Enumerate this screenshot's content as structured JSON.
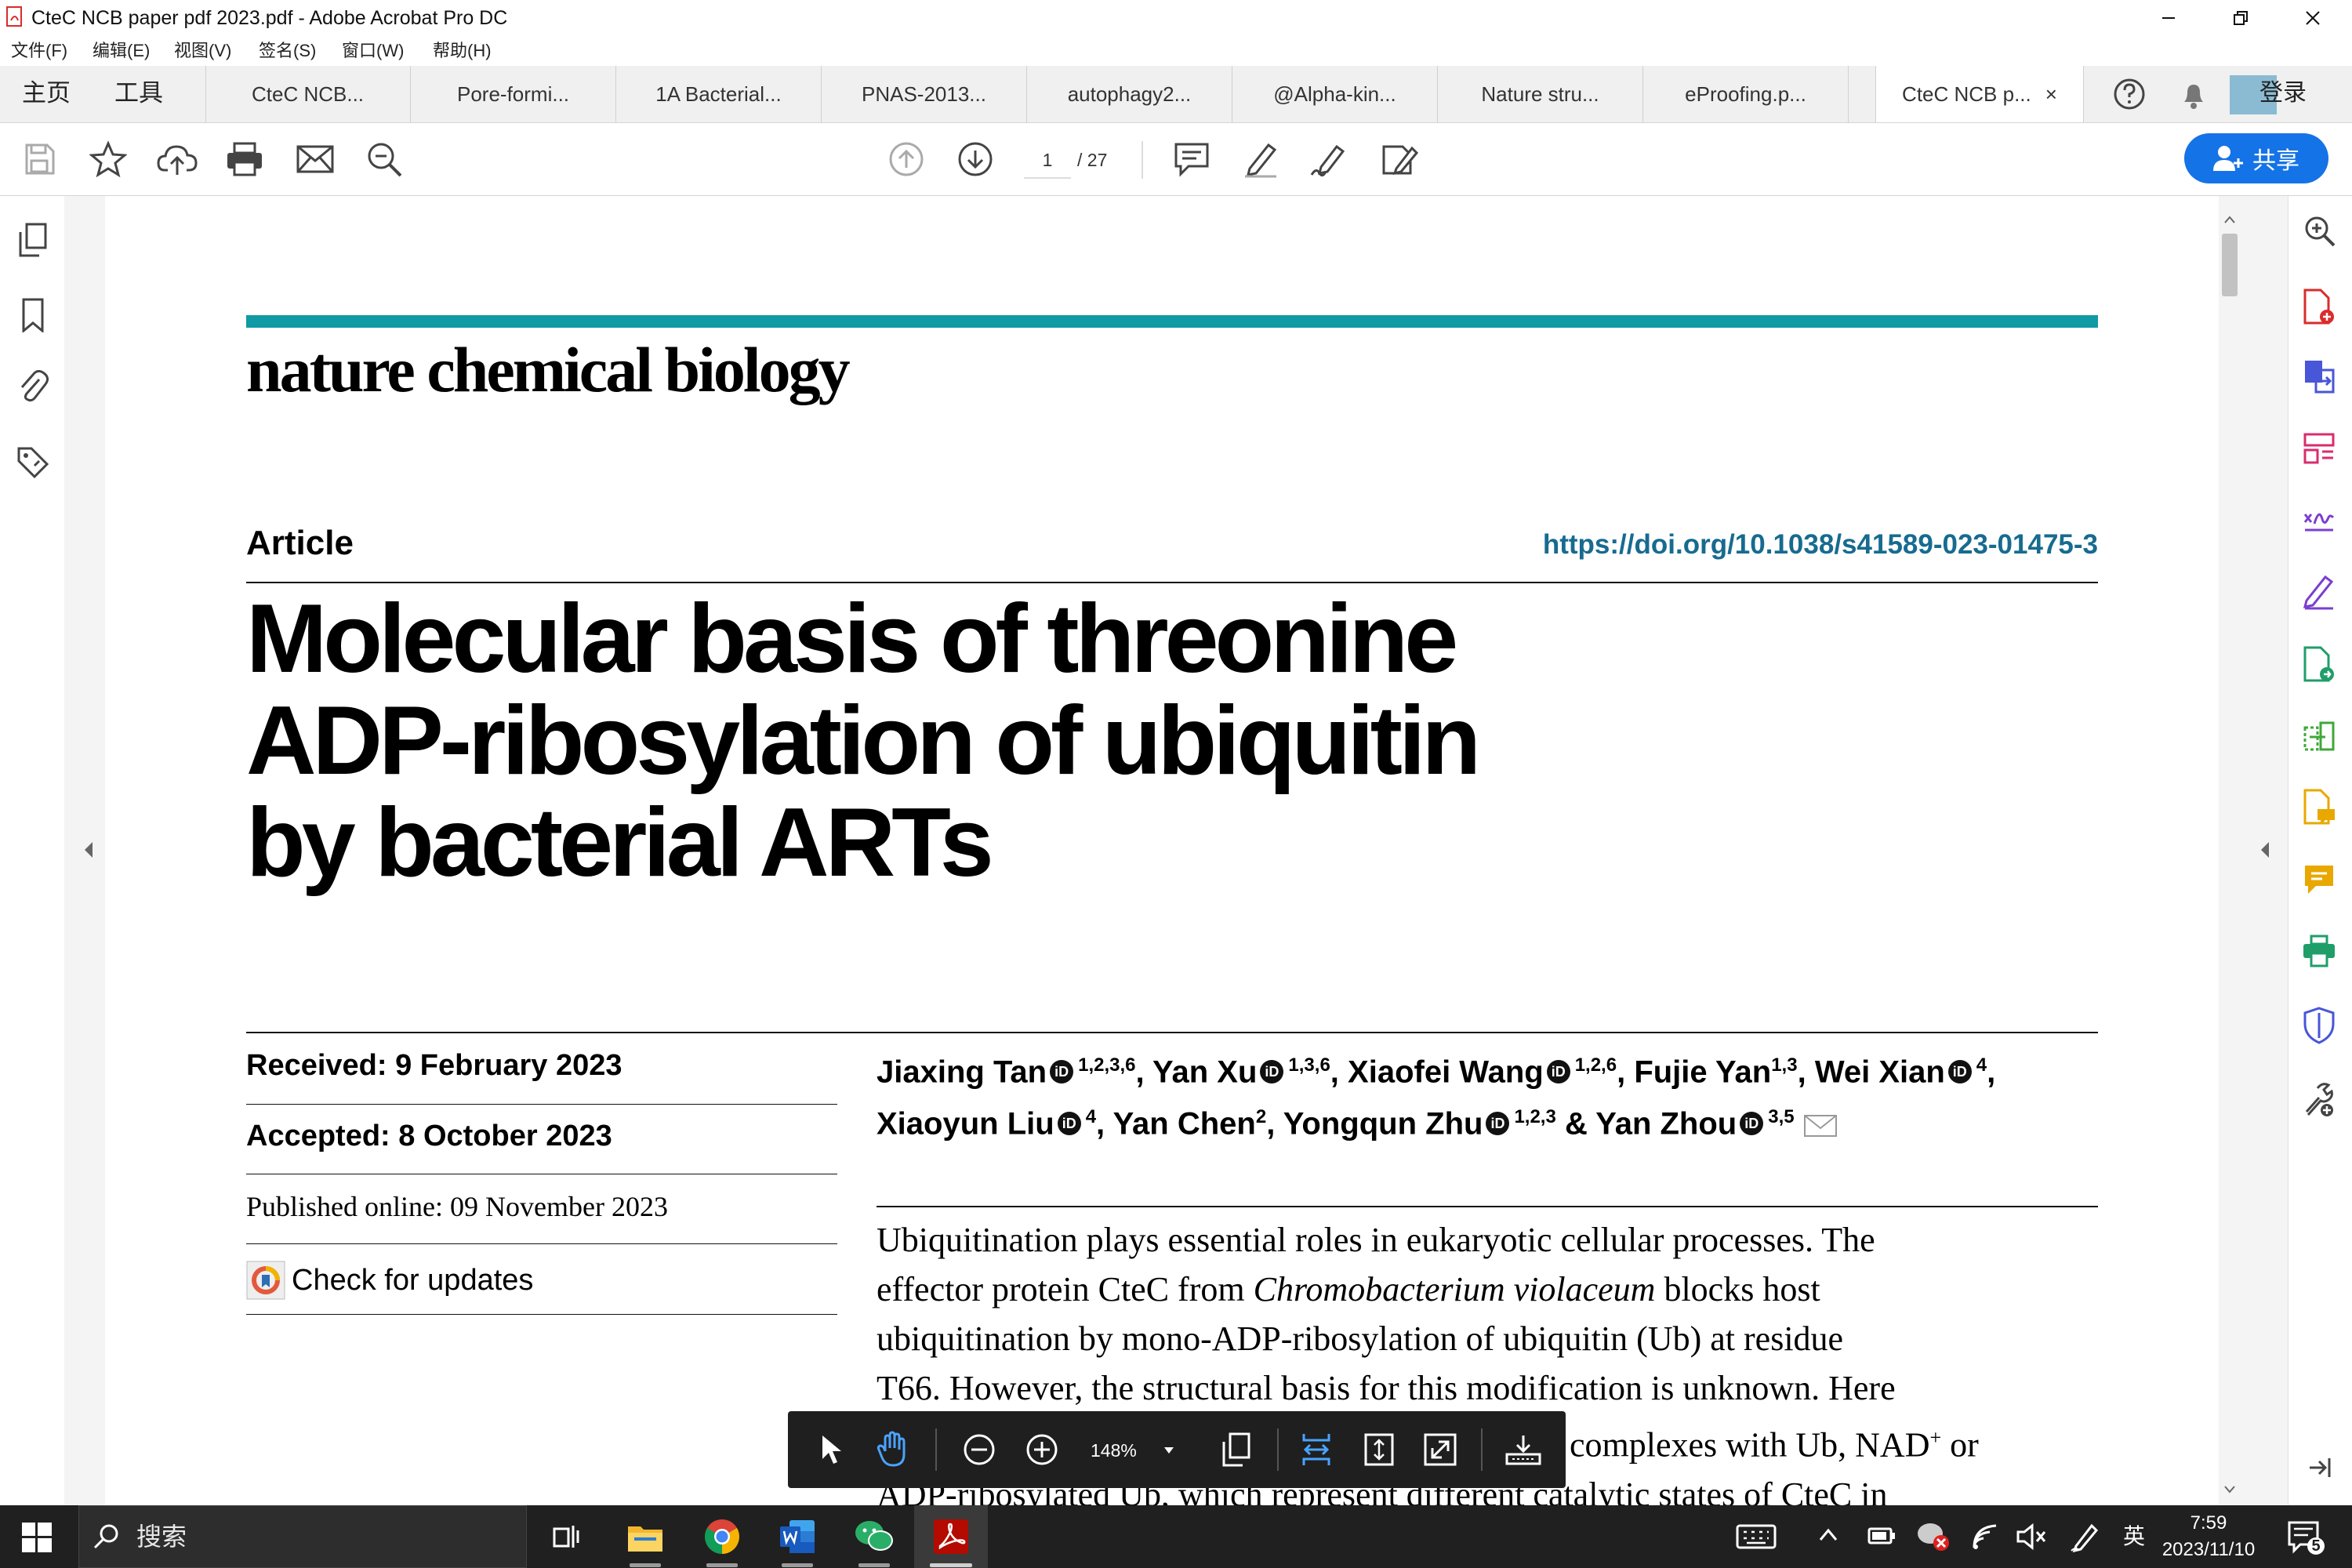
{
  "window": {
    "title": "CteC NCB paper pdf 2023.pdf - Adobe Acrobat Pro DC"
  },
  "menu": [
    "文件(F)",
    "编辑(E)",
    "视图(V)",
    "签名(S)",
    "窗口(W)",
    "帮助(H)"
  ],
  "tabs": {
    "home": "主页",
    "tools": "工具",
    "documents": [
      "CteC NCB...",
      "Pore-formi...",
      "1A Bacterial...",
      "PNAS-2013...",
      "autophagy2...",
      "@Alpha-kin...",
      "Nature stru...",
      "eProofing.p...",
      "CteC NCB p..."
    ],
    "active_index": 8,
    "close_glyph": "×",
    "login": "登录"
  },
  "toolbar": {
    "page_current": "1",
    "page_total": "/ 27",
    "share_label": "共享"
  },
  "document": {
    "journal": "nature chemical biology",
    "article_type": "Article",
    "doi": "https://doi.org/10.1038/s41589-023-01475-3",
    "title_lines": [
      "Molecular basis of threonine",
      "ADP-ribosylation of ubiquitin",
      "by bacterial ARTs"
    ],
    "received": "Received: 9 February 2023",
    "accepted": "Accepted: 8 October 2023",
    "published": "Published online: 09 November 2023",
    "check_updates": "Check for updates",
    "authors": [
      {
        "name": "Jiaxing Tan",
        "aff": "1,2,3,6"
      },
      {
        "name": "Yan Xu",
        "aff": "1,3,6"
      },
      {
        "name": "Xiaofei Wang",
        "aff": "1,2,6"
      },
      {
        "name": "Fujie Yan",
        "aff": "1,3"
      },
      {
        "name": "Wei Xian",
        "aff": "4"
      },
      {
        "name": "Xiaoyun Liu",
        "aff": "4"
      },
      {
        "name": "Yan Chen",
        "aff": "2"
      },
      {
        "name": "Yongqun Zhu",
        "aff": "1,2,3"
      },
      {
        "name": "Yan Zhou",
        "aff": "3,5"
      }
    ],
    "abstract": {
      "line1": "Ubiquitination plays essential roles in eukaryotic cellular processes. The",
      "line2_pre": "effector protein CteC from ",
      "line2_italic": "Chromobacterium violaceum",
      "line2_post": " blocks host",
      "line3": "ubiquitination by mono-ADP-ribosylation of ubiquitin (Ub) at residue",
      "line4": "T66. However, the structural basis for this modification is unknown. Here",
      "line5_visible": "complexes with Ub, NAD",
      "line5_sup": "+",
      "line5_end": " or",
      "line6_partial": "ADP-ribosylated Ub, which represent different catalytic states of CteC in"
    }
  },
  "floating_toolbar": {
    "zoom": "148%"
  },
  "taskbar": {
    "search_label": "搜索",
    "ime": "英",
    "time": "7:59",
    "date": "2023/11/10",
    "notification_count": "5"
  },
  "colors": {
    "teal_rule": "#0f9aa4",
    "doi_link": "#176b8f",
    "share_button": "#1473e6",
    "acrobat_red": "#d92c2c"
  }
}
